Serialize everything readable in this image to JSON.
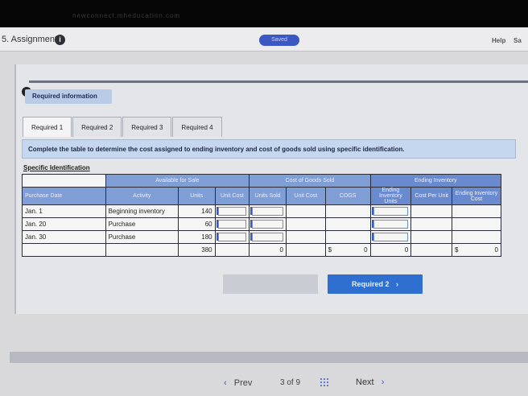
{
  "browser": {
    "url_text": "newconnect.mheducation.com"
  },
  "header": {
    "title": "5. Assignment",
    "info_icon": "i",
    "saved_label": "Saved",
    "help_label": "Help",
    "save_exit_label": "Sa"
  },
  "required_info": {
    "label": "Required information"
  },
  "tabs": [
    {
      "label": "Required 1",
      "active": true
    },
    {
      "label": "Required 2",
      "active": false
    },
    {
      "label": "Required 3",
      "active": false
    },
    {
      "label": "Required 4",
      "active": false
    }
  ],
  "instruction": "Complete the table to determine the cost assigned to ending inventory and cost of goods sold using specific identification.",
  "section_label": "Specific Identification",
  "table": {
    "group_headers": {
      "available": "Available for Sale",
      "cogs": "Cost of Goods Sold",
      "ending": "Ending Inventory"
    },
    "col_headers": {
      "purchase_date": "Purchase Date",
      "activity": "Activity",
      "units": "Units",
      "unit_cost": "Unit Cost",
      "units_sold": "Units Sold",
      "cogs_unit_cost": "Unit Cost",
      "cogs": "COGS",
      "ending_units": "Ending Inventory Units",
      "cost_per_unit": "Cost Per Unit",
      "ending_cost": "Ending Inventory Cost"
    },
    "rows": [
      {
        "date": "Jan. 1",
        "activity": "Beginning inventory",
        "units": "140"
      },
      {
        "date": "Jan. 20",
        "activity": "Purchase",
        "units": "60"
      },
      {
        "date": "Jan. 30",
        "activity": "Purchase",
        "units": "180"
      }
    ],
    "totals": {
      "units": "380",
      "units_sold": "0",
      "cogs_symbol": "$",
      "cogs": "0",
      "ending_units": "0",
      "ending_symbol": "$",
      "ending_cost": "0"
    }
  },
  "buttons": {
    "required2": "Required 2",
    "required2_chev": "›"
  },
  "footer": {
    "prev": "Prev",
    "prev_chev": "‹",
    "page": "3 of 9",
    "next": "Next",
    "next_chev": "›"
  },
  "colors": {
    "accent": "#3b57c4",
    "primary_button": "#2f6fd0",
    "header_blue": "#7f9ed6"
  }
}
